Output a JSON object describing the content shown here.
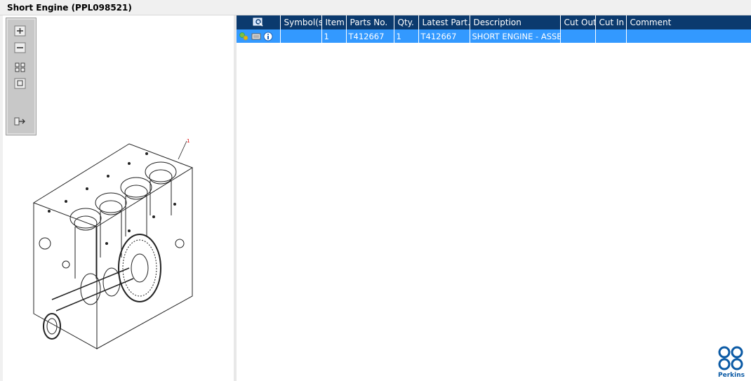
{
  "window": {
    "title": "Short Engine (PPL098521)"
  },
  "toolbar": {
    "zoom_in_icon": "zoom-in-icon",
    "zoom_out_icon": "zoom-out-icon",
    "fit_icon": "fit-to-window-icon",
    "actual_size_icon": "actual-size-icon",
    "export_icon": "export-icon"
  },
  "drawing": {
    "callout_label": "1"
  },
  "table": {
    "headers": [
      "",
      "Symbol(s)",
      "Item",
      "Parts No.",
      "Qty.",
      "Latest Part…",
      "Description",
      "Cut Out",
      "Cut In",
      "Comment"
    ],
    "rows": [
      {
        "symbols": "",
        "item": "1",
        "part_no": "T412667",
        "qty": "1",
        "latest_part": "T412667",
        "description": "SHORT ENGINE - ASSEMBLY",
        "cut_out": "",
        "cut_in": "",
        "comment": ""
      }
    ]
  },
  "brand": {
    "name": "Perkins",
    "color": "#0b5aa5"
  },
  "colors": {
    "header": "#0b3a6e",
    "selected_row": "#3399ff"
  }
}
